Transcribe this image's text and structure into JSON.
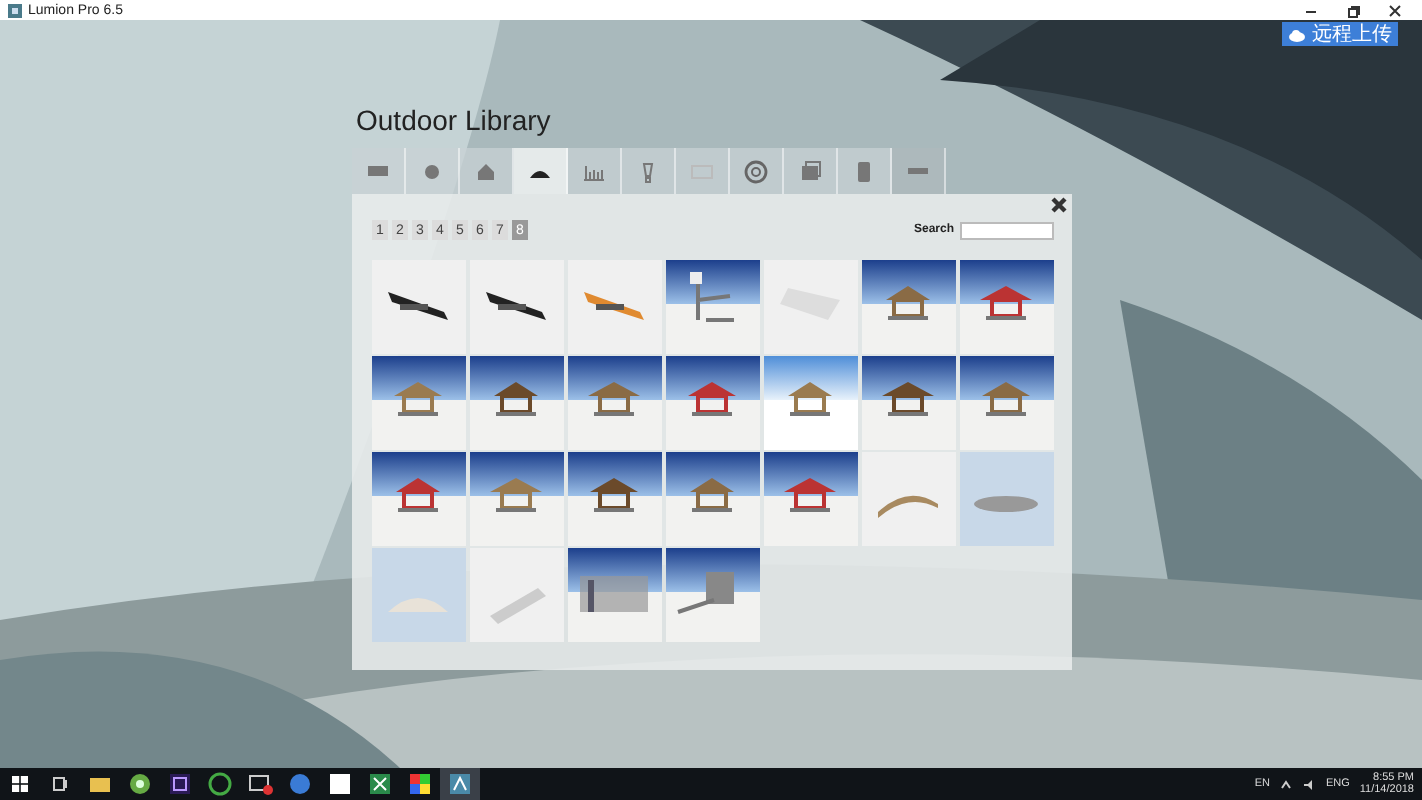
{
  "window": {
    "title": "Lumion Pro 6.5"
  },
  "upload_button": {
    "label": "远程上传"
  },
  "library": {
    "title": "Outdoor Library",
    "tabs": [
      {
        "selected": false
      },
      {
        "selected": false
      },
      {
        "selected": false
      },
      {
        "selected": true
      },
      {
        "selected": false
      },
      {
        "selected": false
      },
      {
        "selected": false
      },
      {
        "selected": false
      },
      {
        "selected": false
      },
      {
        "selected": false
      },
      {
        "selected": false
      }
    ],
    "pages": [
      {
        "label": "1",
        "selected": false
      },
      {
        "label": "2",
        "selected": false
      },
      {
        "label": "3",
        "selected": false
      },
      {
        "label": "4",
        "selected": false
      },
      {
        "label": "5",
        "selected": false
      },
      {
        "label": "6",
        "selected": false
      },
      {
        "label": "7",
        "selected": false
      },
      {
        "label": "8",
        "selected": true
      }
    ],
    "search": {
      "label": "Search"
    }
  },
  "taskbar": {
    "language": "EN",
    "input": "ENG",
    "time": "8:55 PM",
    "date": "11/14/2018"
  }
}
